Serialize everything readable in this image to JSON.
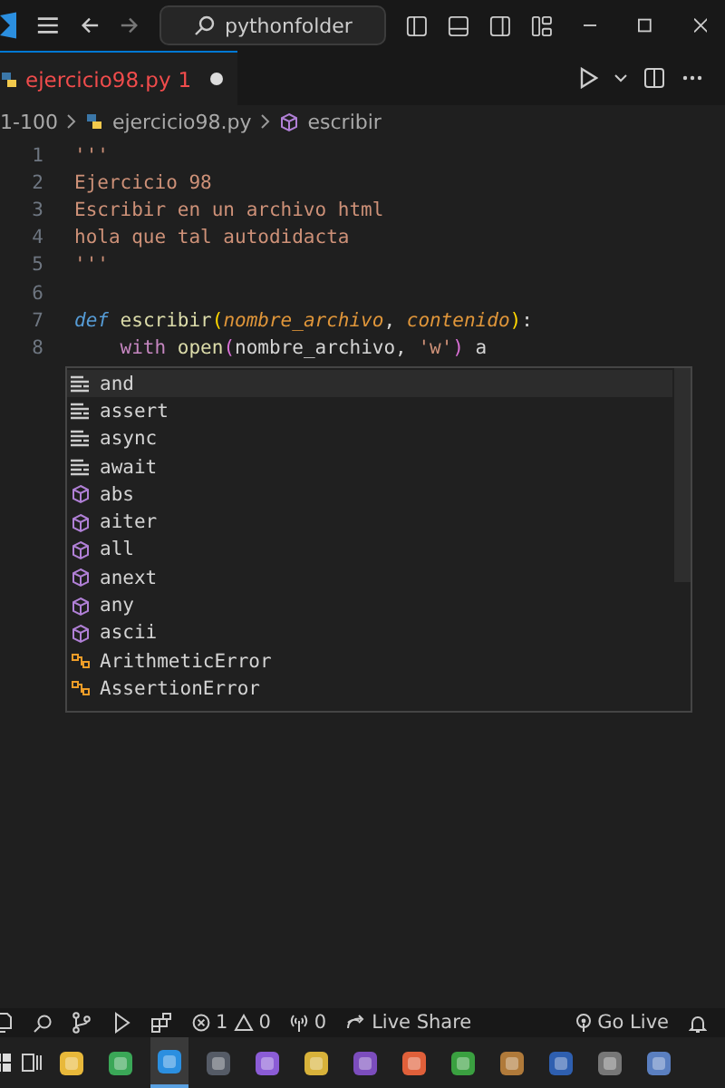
{
  "title_bar": {
    "search": "pythonfolder"
  },
  "tabs": [
    {
      "label": "ejercicio98.py",
      "badge": "1",
      "selected": true,
      "modified": true
    }
  ],
  "breadcrumb": [
    "1-100",
    "ejercicio98.py",
    "escribir"
  ],
  "code_lines": [
    {
      "number": "1",
      "tokens": [
        {
          "text": "'''",
          "kind": "string"
        }
      ]
    },
    {
      "number": "2",
      "tokens": [
        {
          "text": "Ejercicio 98",
          "kind": "string"
        }
      ]
    },
    {
      "number": "3",
      "tokens": [
        {
          "text": "Escribir en un archivo html",
          "kind": "string"
        }
      ]
    },
    {
      "number": "4",
      "tokens": [
        {
          "text": "hola que tal autodidacta",
          "kind": "string"
        }
      ]
    },
    {
      "number": "5",
      "tokens": [
        {
          "text": "'''",
          "kind": "string"
        }
      ]
    },
    {
      "number": "6"
    },
    {
      "number": "7",
      "tokens": [
        {
          "text": "def ",
          "kind": "keyword"
        },
        {
          "text": "escribir",
          "kind": "function"
        },
        {
          "text": "(",
          "kind": "bracket"
        },
        {
          "text": "nombre_archivo",
          "kind": "param"
        },
        {
          "text": ", ",
          "kind": "plain"
        },
        {
          "text": "contenido",
          "kind": "param"
        },
        {
          "text": ")",
          "kind": "bracket"
        },
        {
          "text": ":",
          "kind": "plain"
        }
      ]
    },
    {
      "number": "8",
      "tokens": [
        {
          "text": "    with ",
          "kind": "control"
        },
        {
          "text": "open",
          "kind": "function2"
        },
        {
          "text": "(",
          "kind": "bracket2"
        },
        {
          "text": "nombre_archivo, ",
          "kind": "plain"
        },
        {
          "text": "'w'",
          "kind": "string"
        },
        {
          "text": ")",
          "kind": "bracket2"
        },
        {
          "text": " a",
          "kind": "plain"
        }
      ]
    }
  ],
  "suggestions": [
    {
      "label": "and",
      "kind": "keyword",
      "selected": true
    },
    {
      "label": "assert",
      "kind": "keyword",
      "selected": false
    },
    {
      "label": "async",
      "kind": "keyword",
      "selected": false
    },
    {
      "label": "await",
      "kind": "keyword",
      "selected": false
    },
    {
      "label": "abs",
      "kind": "function",
      "selected": false
    },
    {
      "label": "aiter",
      "kind": "function",
      "selected": false
    },
    {
      "label": "all",
      "kind": "function",
      "selected": false
    },
    {
      "label": "anext",
      "kind": "function",
      "selected": false
    },
    {
      "label": "any",
      "kind": "function",
      "selected": false
    },
    {
      "label": "ascii",
      "kind": "function",
      "selected": false
    },
    {
      "label": "ArithmeticError",
      "kind": "class",
      "selected": false
    },
    {
      "label": "AssertionError",
      "kind": "class",
      "selected": false
    }
  ],
  "status_bar": {
    "errors": "1",
    "warnings": "0",
    "ports": "0",
    "live_share": "Live Share",
    "go_live": "Go Live"
  }
}
